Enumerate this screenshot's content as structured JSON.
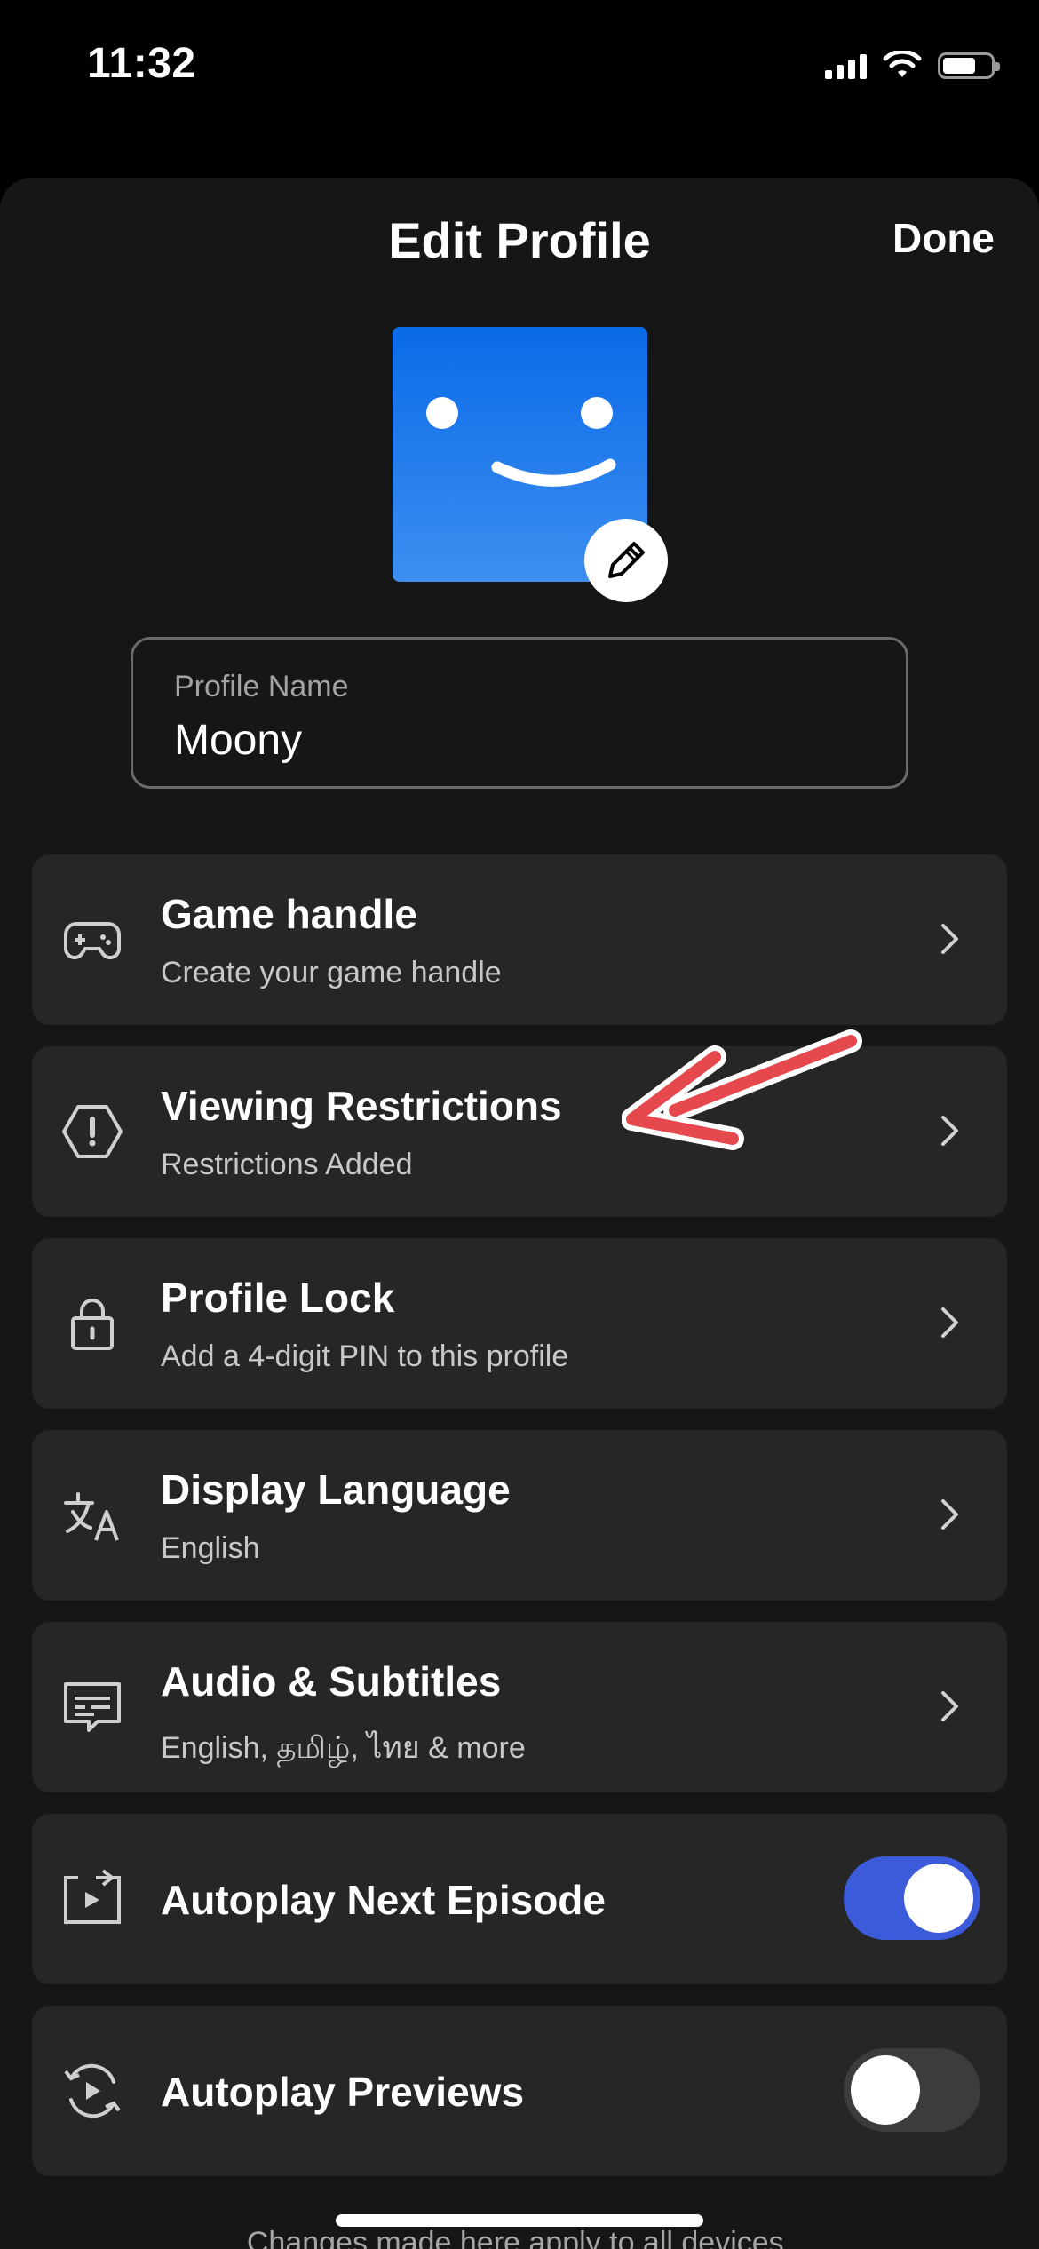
{
  "status_bar": {
    "time": "11:32"
  },
  "header": {
    "title": "Edit Profile",
    "done_label": "Done"
  },
  "profile_name": {
    "label": "Profile Name",
    "value": "Moony"
  },
  "rows": [
    {
      "icon": "gamepad-icon",
      "title": "Game handle",
      "subtitle": "Create your game handle"
    },
    {
      "icon": "warning-hexagon-icon",
      "title": "Viewing Restrictions",
      "subtitle": "Restrictions Added"
    },
    {
      "icon": "lock-icon",
      "title": "Profile Lock",
      "subtitle": "Add a 4-digit PIN to this profile"
    },
    {
      "icon": "translate-icon",
      "title": "Display Language",
      "subtitle": "English"
    },
    {
      "icon": "subtitles-icon",
      "title": "Audio & Subtitles",
      "subtitle": "English, தமிழ், ไทย & more"
    }
  ],
  "toggles": [
    {
      "icon": "autoplay-next-icon",
      "title": "Autoplay Next Episode",
      "state": "on"
    },
    {
      "icon": "autoplay-previews-icon",
      "title": "Autoplay Previews",
      "state": "off"
    }
  ],
  "footnote": "Changes made here apply to all devices.",
  "colors": {
    "toggle_on": "#3b5bdb",
    "avatar": "#0a6be8",
    "annotation_arrow": "#e5484d"
  }
}
